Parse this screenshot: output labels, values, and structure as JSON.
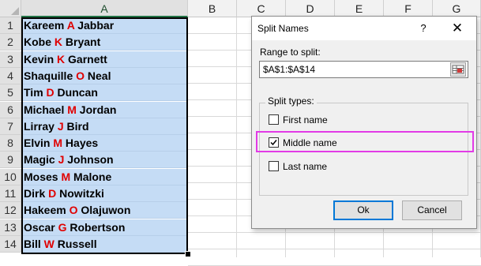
{
  "sheet": {
    "columns": [
      "A",
      "B",
      "C",
      "D",
      "E",
      "F",
      "G"
    ],
    "rows": [
      {
        "num": "1",
        "first": "Kareem ",
        "middle": "A",
        "last": " Jabbar"
      },
      {
        "num": "2",
        "first": "Kobe ",
        "middle": "K",
        "last": " Bryant"
      },
      {
        "num": "3",
        "first": "Kevin ",
        "middle": "K",
        "last": " Garnett"
      },
      {
        "num": "4",
        "first": "Shaquille ",
        "middle": "O",
        "last": " Neal"
      },
      {
        "num": "5",
        "first": "Tim ",
        "middle": "D",
        "last": " Duncan"
      },
      {
        "num": "6",
        "first": "Michael ",
        "middle": "M",
        "last": " Jordan"
      },
      {
        "num": "7",
        "first": "Lirray ",
        "middle": "J",
        "last": " Bird"
      },
      {
        "num": "8",
        "first": "Elvin ",
        "middle": "M",
        "last": " Hayes"
      },
      {
        "num": "9",
        "first": "Magic ",
        "middle": "J",
        "last": " Johnson"
      },
      {
        "num": "10",
        "first": "Moses ",
        "middle": "M",
        "last": " Malone"
      },
      {
        "num": "11",
        "first": "Dirk ",
        "middle": "D",
        "last": " Nowitzki"
      },
      {
        "num": "12",
        "first": "Hakeem ",
        "middle": "O",
        "last": " Olajuwon"
      },
      {
        "num": "13",
        "first": "Oscar ",
        "middle": "G",
        "last": " Robertson"
      },
      {
        "num": "14",
        "first": "Bill ",
        "middle": "W",
        "last": " Russell"
      }
    ]
  },
  "dialog": {
    "title": "Split Names",
    "help": "?",
    "close": "✕",
    "range_label": "Range to split:",
    "range_value": "$A$1:$A$14",
    "split_types_label": "Split types:",
    "options": [
      {
        "label": "First name",
        "checked": false
      },
      {
        "label": "Middle name",
        "checked": true
      },
      {
        "label": "Last name",
        "checked": false
      }
    ],
    "ok_label": "Ok",
    "cancel_label": "Cancel"
  },
  "colors": {
    "selection_fill": "#c5dcf5",
    "middle_initial": "#e00000",
    "highlight_box": "#e23be6"
  },
  "icons": {
    "range_picker": "range-select-icon",
    "close": "close-icon",
    "help": "help-icon",
    "check": "check-icon"
  }
}
